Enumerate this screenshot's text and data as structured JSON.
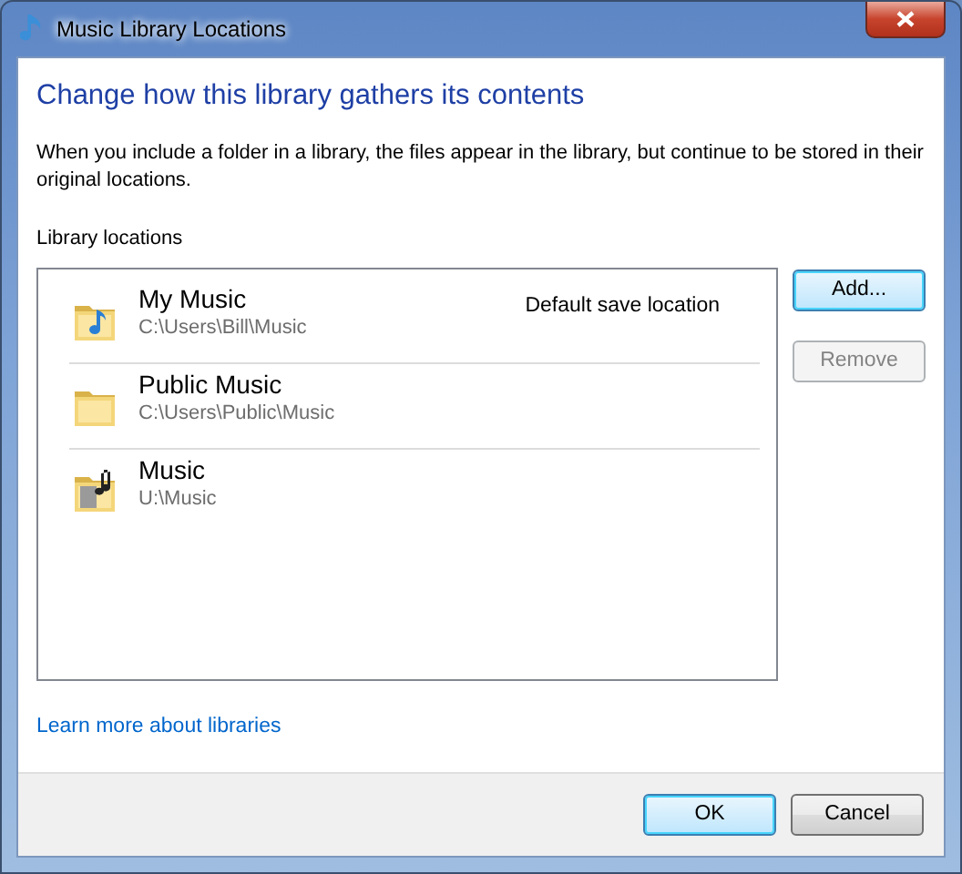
{
  "window": {
    "title": "Music Library Locations"
  },
  "heading": "Change how this library gathers its contents",
  "description": "When you include a folder in a library, the files appear in the library, but continue to be stored in their original locations.",
  "locations_label": "Library locations",
  "locations": [
    {
      "kind": "note-folder",
      "name": "My Music",
      "path": "C:\\Users\\Bill\\Music",
      "badge": "Default save location"
    },
    {
      "kind": "plain-folder",
      "name": "Public Music",
      "path": "C:\\Users\\Public\\Music"
    },
    {
      "kind": "media-folder",
      "name": "Music",
      "path": "U:\\Music"
    }
  ],
  "side_buttons": [
    {
      "label": "Add...",
      "disabled": false,
      "default": true
    },
    {
      "label": "Remove",
      "disabled": true,
      "default": false
    }
  ],
  "link": "Learn more about libraries",
  "footer_buttons": [
    {
      "label": "OK",
      "disabled": false,
      "default": true
    },
    {
      "label": "Cancel",
      "disabled": false,
      "default": false
    }
  ]
}
